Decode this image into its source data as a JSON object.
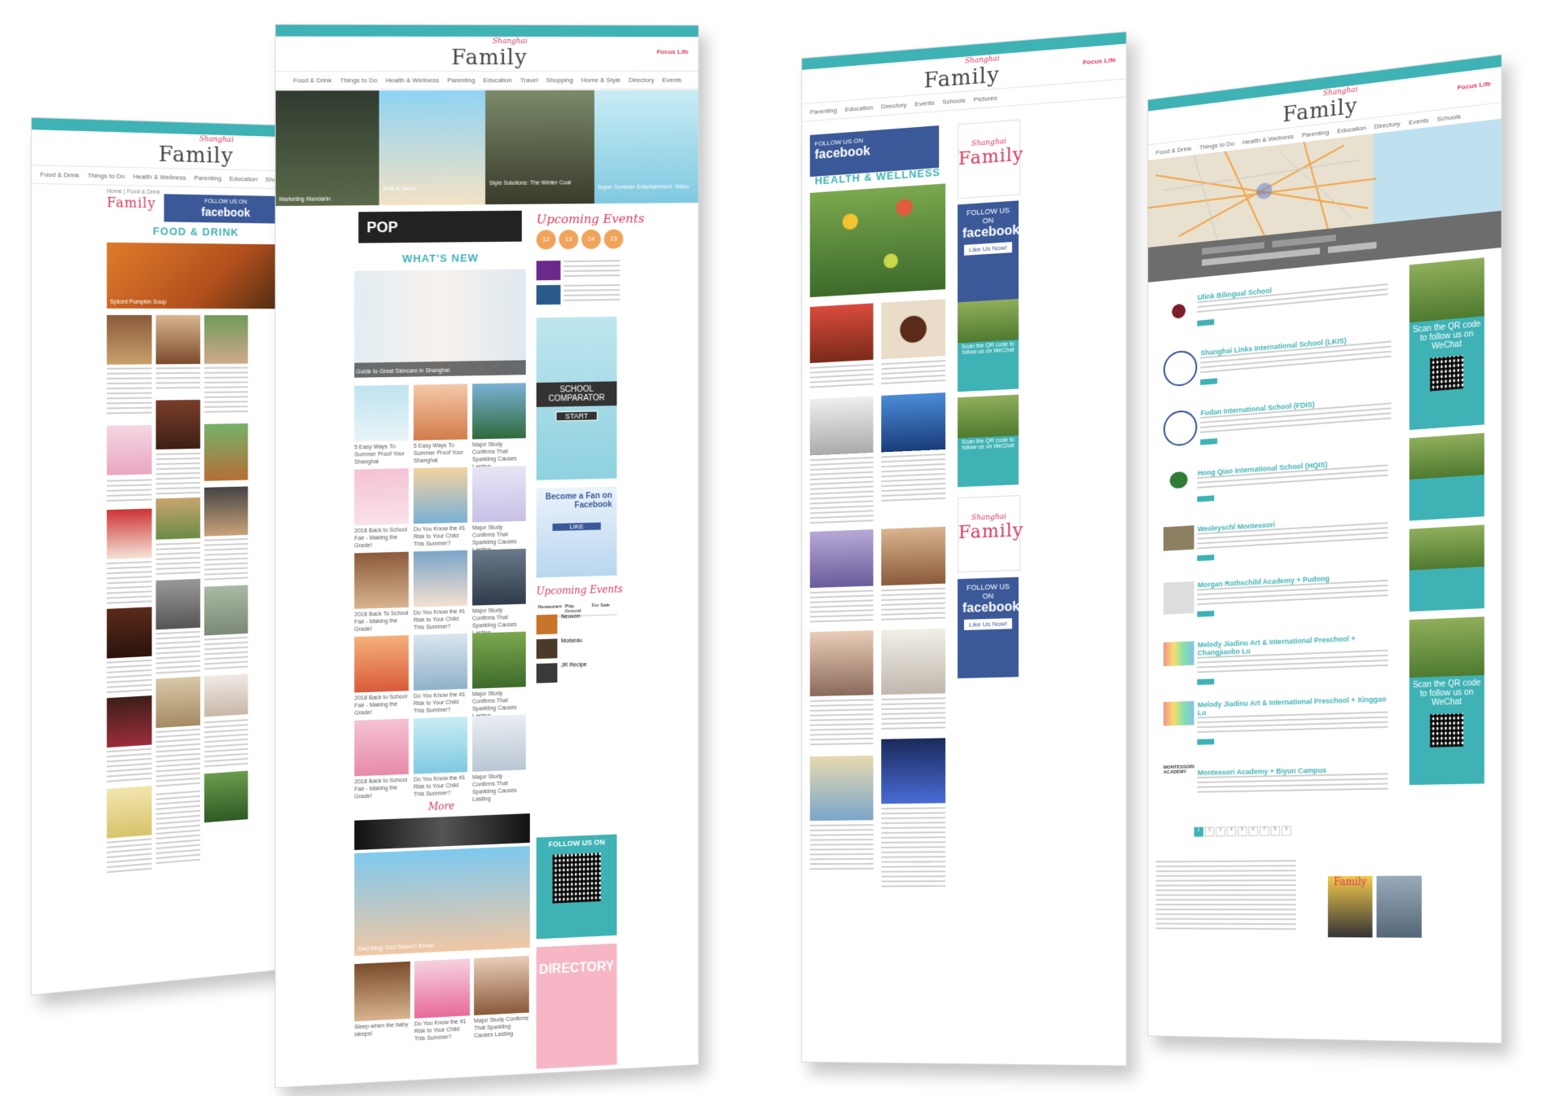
{
  "brand": {
    "logo_small": "Shanghai",
    "logo_big": "Family",
    "sponsor": "Focus Life"
  },
  "nav": [
    "Food & Drink",
    "Things to Do",
    "Health & Wellness",
    "Parenting",
    "Education",
    "Travel",
    "Shopping",
    "Home & Style",
    "Directory",
    "Events",
    "Schools",
    "Pictures"
  ],
  "facebook": {
    "follow": "FOLLOW US ON",
    "word": "facebook",
    "like": "Like Us Now!"
  },
  "page1": {
    "breadcrumb": "Home | Food & Drink",
    "section": "FOOD & DRINK",
    "hero_caption": "Spiced Pumpkin Soup"
  },
  "page2": {
    "banner_text": "POP",
    "section": "WHAT'S NEW",
    "hero_caption": "Guide to Great Skincare in Shanghai",
    "grid_captions": [
      "5 Easy Ways To Summer Proof Your Shanghai",
      "5 Easy Ways To Summer Proof Your Shanghai",
      "Major Study Confirms That Sparkling Causes Lasting",
      "2018 Back to School Fair - Making the Grade!",
      "Do You Know the #1 Risk to Your Child This Summer?",
      "Major Study Confirms That Sparkling Causes Lasting",
      "2018 Back To School Fair - Making the Grade!",
      "Do You Know the #1 Risk to Your Child This Summer?",
      "Major Study Confirms That Sparkling Causes Lasting",
      "2018 Back to School Fair - Making the Grade!",
      "Do You Know the #1 Risk to Your Child This Summer?",
      "Major Study Confirms That Sparkling Causes Lasting",
      "2018 Back to School Fair - Making the Grade!",
      "Do You Know the #1 Risk to Your Child This Summer?",
      "Major Study Confirms That Sparkling Causes Lasting"
    ],
    "top_captions": [
      "Marketing Mandarin",
      "Kids & Swim",
      "Style Solutions: The Winter Coat",
      "Super Summer Entertainment: Video"
    ],
    "upcoming": "Upcoming Events",
    "event_days": [
      "12",
      "13",
      "14",
      "15"
    ],
    "school_comparator": "SCHOOL COMPARATOR",
    "start": "START",
    "become_fan": "Become a Fan on Facebook",
    "like": "LIKE",
    "tabs": [
      "Restaurant",
      "Play Ground",
      "For Sale"
    ],
    "list_items": [
      "Neuvon",
      "Moiseau",
      "JR Recipe"
    ],
    "more": "More",
    "big_caption": "Dad Blog: Dad Doesn't Know!",
    "follow_us_on": "FOLLOW US ON",
    "directory": "DIRECTORY",
    "bottom_captions": [
      "Sleep when the baby sleeps!",
      "Do You Know the #1 Risk to Your Child This Summer?",
      "Major Study Confirms That Sparkling Causes Lasting"
    ]
  },
  "page3": {
    "section": "HEALTH & WELLNESS",
    "like": "Like Us Now!",
    "qr_text": "Scan the QR code to follow us on WeChat"
  },
  "page4": {
    "schools": [
      {
        "name": "Ulink Bilingual School"
      },
      {
        "name": "Shanghai Links International School (LKIS)"
      },
      {
        "name": "Fudan International School (FDIS)"
      },
      {
        "name": "Hong Qiao International School (HQIS)"
      },
      {
        "name": "Wesleyschl Montessori"
      },
      {
        "name": "Morgan Rothschild Academy + Pudong"
      },
      {
        "name": "Melody Jiadinu Art & International Preschool + Changjiaobo Lu"
      },
      {
        "name": "Melody Jiadinu Art & International Preschool + Xinggao Lu"
      },
      {
        "name": "Montessori Academy + Biyun Campus"
      }
    ],
    "qr_text": "Scan the QR code to follow us on WeChat",
    "pages": [
      "1",
      "2",
      "3",
      "4",
      "5",
      "6",
      "7",
      "8",
      "9"
    ],
    "montessori_label": "MONTESSORI ACADEMY",
    "magazine_title": "Family"
  }
}
